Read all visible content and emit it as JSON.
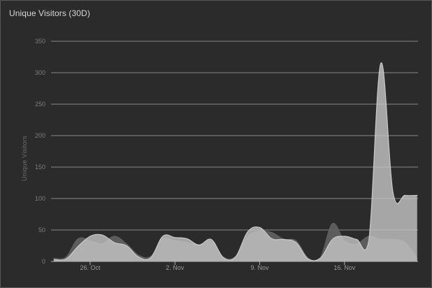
{
  "panel": {
    "title": "Unique Visitors (30D)"
  },
  "chart_data": {
    "type": "area",
    "title": "Unique Visitors (30D)",
    "xlabel": "",
    "ylabel": "Unique Visitors",
    "ylim": [
      0,
      350
    ],
    "yticks": [
      0,
      50,
      100,
      150,
      200,
      250,
      300,
      350
    ],
    "xticks": [
      "26. Oct",
      "2. Nov",
      "9. Nov",
      "16. Nov"
    ],
    "x": [
      "23. Oct",
      "24. Oct",
      "25. Oct",
      "26. Oct",
      "27. Oct",
      "28. Oct",
      "29. Oct",
      "30. Oct",
      "31. Oct",
      "1. Nov",
      "2. Nov",
      "3. Nov",
      "4. Nov",
      "5. Nov",
      "6. Nov",
      "7. Nov",
      "8. Nov",
      "9. Nov",
      "10. Nov",
      "11. Nov",
      "12. Nov",
      "13. Nov",
      "14. Nov",
      "15. Nov",
      "16. Nov",
      "17. Nov",
      "18. Nov",
      "19. Nov",
      "20. Nov",
      "21. Nov",
      "22. Nov"
    ],
    "grid": true,
    "legend": "none",
    "series": [
      {
        "color": "#5f5f5f",
        "values": [
          5,
          7,
          36,
          33,
          28,
          40,
          28,
          10,
          8,
          36,
          33,
          30,
          27,
          32,
          7,
          8,
          40,
          48,
          46,
          35,
          33,
          5,
          6,
          60,
          33,
          28,
          40,
          35,
          35,
          30,
          5
        ]
      },
      {
        "color": "#c9c9c9",
        "values": [
          3,
          4,
          24,
          40,
          42,
          30,
          25,
          7,
          6,
          40,
          38,
          36,
          26,
          35,
          6,
          7,
          47,
          54,
          36,
          35,
          30,
          4,
          5,
          35,
          40,
          35,
          32,
          315,
          110,
          105,
          105
        ]
      }
    ]
  }
}
